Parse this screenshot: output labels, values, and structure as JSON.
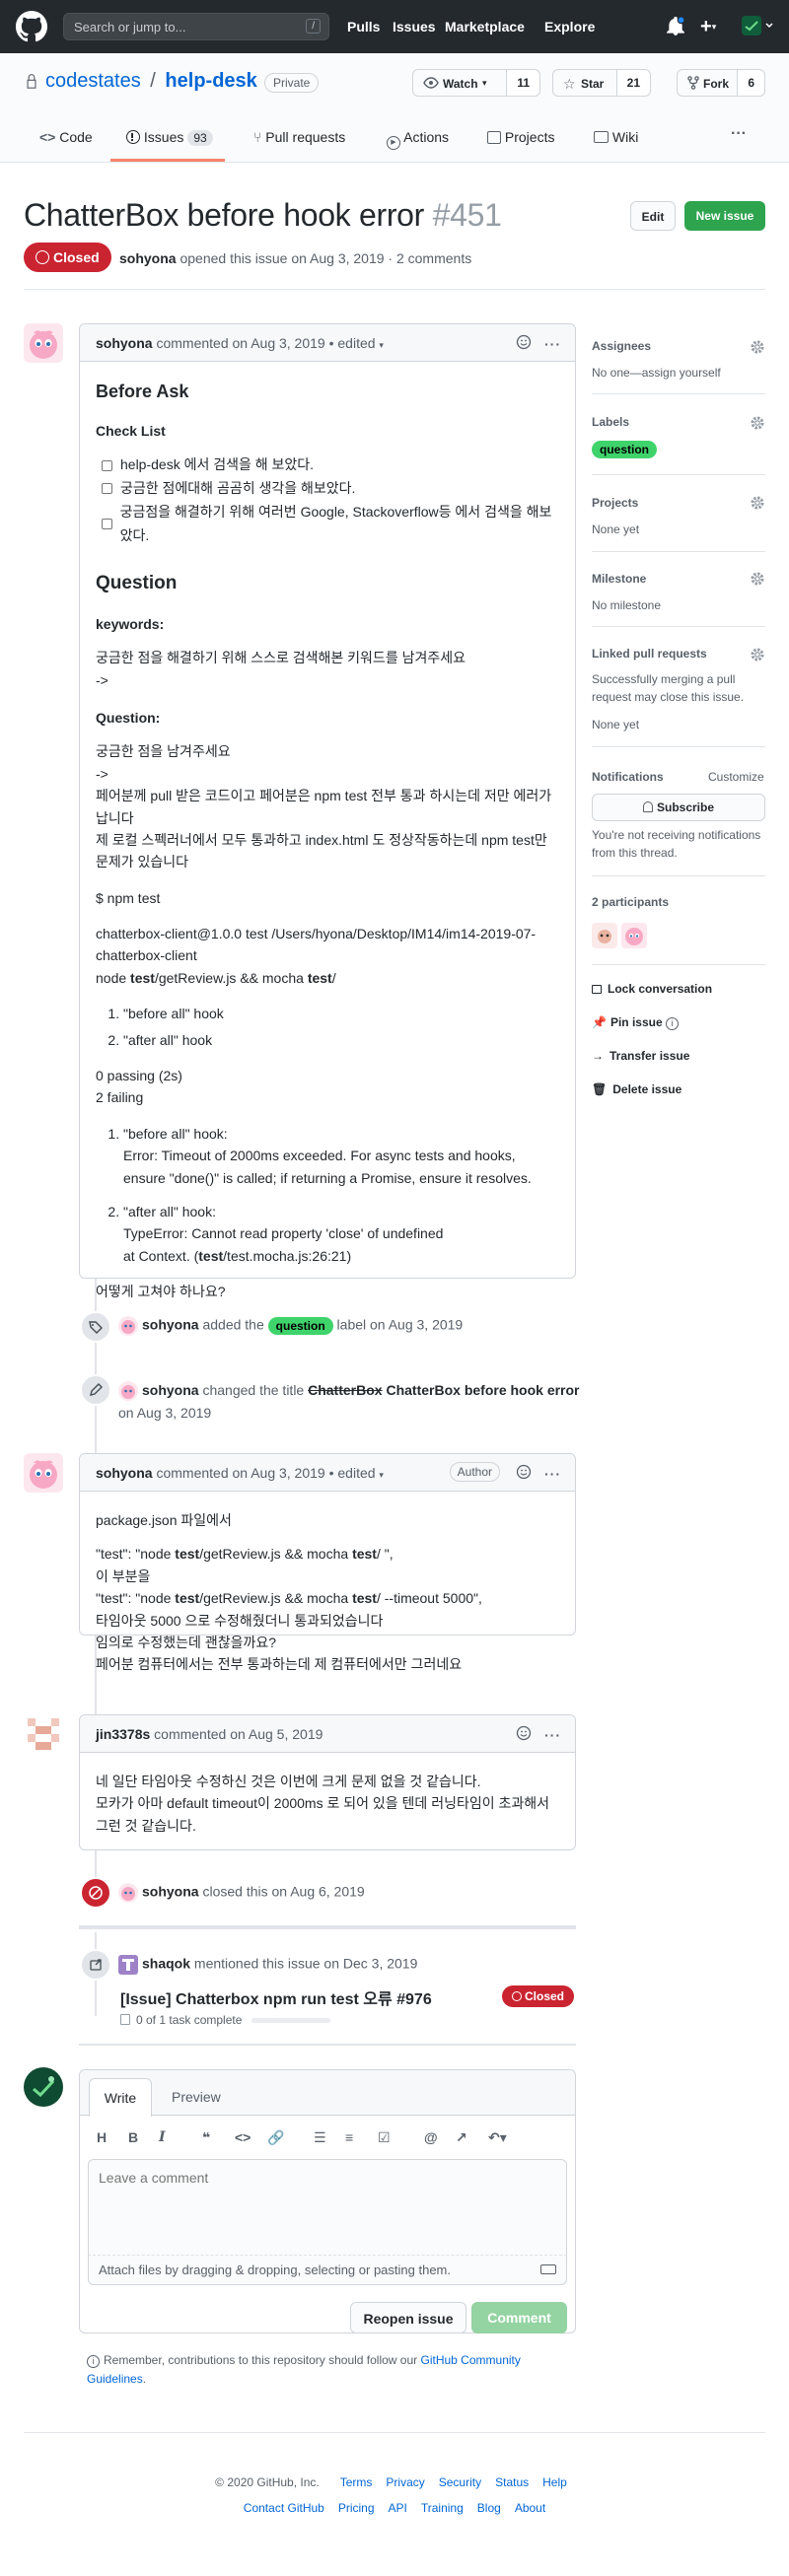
{
  "header": {
    "search_placeholder": "Search or jump to...",
    "search_key": "/",
    "nav": [
      "Pulls",
      "Issues",
      "Marketplace",
      "Explore"
    ]
  },
  "repo": {
    "owner": "codestates",
    "name": "help-desk",
    "visibility": "Private",
    "watch_label": "Watch",
    "watch_count": "11",
    "star_label": "Star",
    "star_count": "21",
    "fork_label": "Fork",
    "fork_count": "6",
    "tabs": [
      {
        "label": "Code"
      },
      {
        "label": "Issues",
        "count": "93"
      },
      {
        "label": "Pull requests"
      },
      {
        "label": "Actions"
      },
      {
        "label": "Projects"
      },
      {
        "label": "Wiki"
      }
    ],
    "more": "···"
  },
  "issue": {
    "title": "ChatterBox before hook error",
    "number": "#451",
    "state": "Closed",
    "author": "sohyona",
    "meta": "opened this issue on Aug 3, 2019 · 2 comments",
    "edit_label": "Edit",
    "new_issue_label": "New issue"
  },
  "comment1": {
    "author": "sohyona",
    "meta": "commented on Aug 3, 2019 • edited",
    "h_before_ask": "Before Ask",
    "h_checklist": "Check List",
    "checklist": [
      "help-desk 에서 검색을 해 보았다.",
      "궁금한 점에대해 곰곰히 생각을 해보았다.",
      "궁금점을 해결하기 위해 여러번 Google, Stackoverflow등 에서 검색을 해보았다."
    ],
    "h_question": "Question",
    "h_keywords": "keywords:",
    "keywords_text": "궁금한 점을 해결하기 위해 스스로 검색해본 키워드를 남겨주세요",
    "arrow": "->",
    "h_question2": "Question:",
    "q_line1": "궁금한 점을 남겨주세요",
    "q_line2": "->",
    "q_line3": "페어분께 pull 받은 코드이고 페어분은 npm test 전부 통과 하시는데 저만 에러가 납니다",
    "q_line4": "제 로컬 스펙러너에서 모두 통과하고 index.html 도 정상작동하는데 npm test만 문제가 있습니다",
    "cmd": "$ npm test",
    "out1": "chatterbox-client@1.0.0 test /Users/hyona/Desktop/IM14/im14-2019-07-chatterbox-client",
    "out2a": "node ",
    "out2b": "test",
    "out2c": "/getReview.js && mocha ",
    "out2d": "test",
    "out2e": "/",
    "hooks": [
      "\"before all\" hook",
      "\"after all\" hook"
    ],
    "passing": "0 passing (2s)",
    "failing": "2 failing",
    "fail1_a": "\"before all\" hook:",
    "fail1_b": "Error: Timeout of 2000ms exceeded. For async tests and hooks, ensure \"done()\" is called; if returning a Promise, ensure it resolves.",
    "fail2_a": "\"after all\" hook:",
    "fail2_b": "TypeError: Cannot read property 'close' of undefined",
    "fail2_c1": "at Context. (",
    "fail2_c2": "test",
    "fail2_c3": "/test.mocha.js:26:21)",
    "closing": "어떻게 고쳐야 하나요?"
  },
  "event_label": {
    "author": "sohyona",
    "text1": "added the",
    "label": "question",
    "text2": "label on Aug 3, 2019"
  },
  "event_title": {
    "author": "sohyona",
    "text1": "changed the title",
    "old": "ChatterBox",
    "new": "ChatterBox before hook error",
    "date": "on Aug 3, 2019"
  },
  "comment2": {
    "author": "sohyona",
    "meta": "commented on Aug 3, 2019 • edited",
    "tag": "Author",
    "l1": "package.json 파일에서",
    "l2a": "\"test\": \"node ",
    "l2b": "test",
    "l2c": "/getReview.js && mocha ",
    "l2d": "test",
    "l2e": "/ \",",
    "l3": "이 부분을",
    "l4a": "\"test\": \"node ",
    "l4b": "test",
    "l4c": "/getReview.js && mocha ",
    "l4d": "test",
    "l4e": "/ --timeout 5000\",",
    "l5": "타임아웃 5000 으로 수정해줬더니 통과되었습니다",
    "l6": "임의로 수정했는데 괜찮을까요?",
    "l7": "페어분 컴퓨터에서는 전부 통과하는데 제 컴퓨터에서만 그러네요"
  },
  "comment3": {
    "author": "jin3378s",
    "meta": "commented on Aug 5, 2019",
    "l1": "네 일단 타임아웃 수정하신 것은 이번에 크게 문제 없을 것 같습니다.",
    "l2": "모카가 아마 default timeout이 2000ms 로 되어 있을 텐데 러닝타임이 초과해서 그런 것 같습니다."
  },
  "event_closed": {
    "author": "sohyona",
    "text": "closed this on Aug 6, 2019"
  },
  "event_mention": {
    "author": "shaqok",
    "text": "mentioned this issue on Dec 3, 2019",
    "ref_title": "[Issue] Chatterbox npm run test 오류 #976",
    "ref_state": "Closed",
    "tasks": "0 of 1 task complete"
  },
  "editor": {
    "tab_write": "Write",
    "tab_preview": "Preview",
    "placeholder": "Leave a comment",
    "attach": "Attach files by dragging & dropping, selecting or pasting them.",
    "reopen": "Reopen issue",
    "comment": "Comment",
    "notice1": "Remember, contributions to this repository should follow our ",
    "notice_link": "GitHub Community Guidelines",
    "notice2": "."
  },
  "sidebar": {
    "assignees_h": "Assignees",
    "assignees_t": "No one—assign yourself",
    "labels_h": "Labels",
    "label": "question",
    "projects_h": "Projects",
    "projects_t": "None yet",
    "milestone_h": "Milestone",
    "milestone_t": "No milestone",
    "linked_h": "Linked pull requests",
    "linked_t": "Successfully merging a pull request may close this issue.",
    "linked_t2": "None yet",
    "notif_h": "Notifications",
    "customize": "Customize",
    "subscribe": "Subscribe",
    "notif_t": "You're not receiving notifications from this thread.",
    "participants_h": "2 participants",
    "lock": "Lock conversation",
    "pin": "Pin issue",
    "transfer": "Transfer issue",
    "delete": "Delete issue"
  },
  "footer": {
    "copy": "© 2020 GitHub, Inc.",
    "links1": [
      "Terms",
      "Privacy",
      "Security",
      "Status",
      "Help"
    ],
    "links2": [
      "Contact GitHub",
      "Pricing",
      "API",
      "Training",
      "Blog",
      "About"
    ]
  },
  "colors": {
    "header_bg": "#24292e",
    "closed_red": "#cb2431",
    "green": "#2ea44f",
    "label_green": "#3fd36b",
    "link_blue": "#0366d6"
  }
}
